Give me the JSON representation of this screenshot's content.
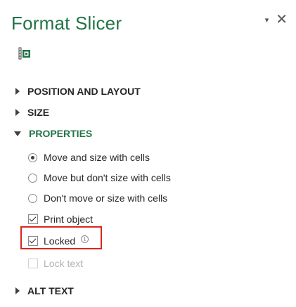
{
  "pane": {
    "title": "Format Slicer",
    "dropdown_glyph": "▾",
    "close_glyph": "✕",
    "tab_icon": "size-properties-icon"
  },
  "sections": {
    "position_layout": "POSITION AND LAYOUT",
    "size": "SIZE",
    "properties": "PROPERTIES",
    "alt_text": "ALT TEXT"
  },
  "properties": {
    "radio_options": [
      {
        "label": "Move and size with cells",
        "checked": true
      },
      {
        "label": "Move but don't size with cells",
        "checked": false
      },
      {
        "label": "Don't move or size with cells",
        "checked": false
      }
    ],
    "print_object": {
      "label": "Print object",
      "checked": true
    },
    "locked": {
      "label": "Locked",
      "checked": true,
      "info_icon": "info-icon"
    },
    "lock_text": {
      "label": "Lock text",
      "checked": false,
      "enabled": false
    }
  },
  "colors": {
    "accent": "#217346",
    "highlight": "#d9261c"
  }
}
